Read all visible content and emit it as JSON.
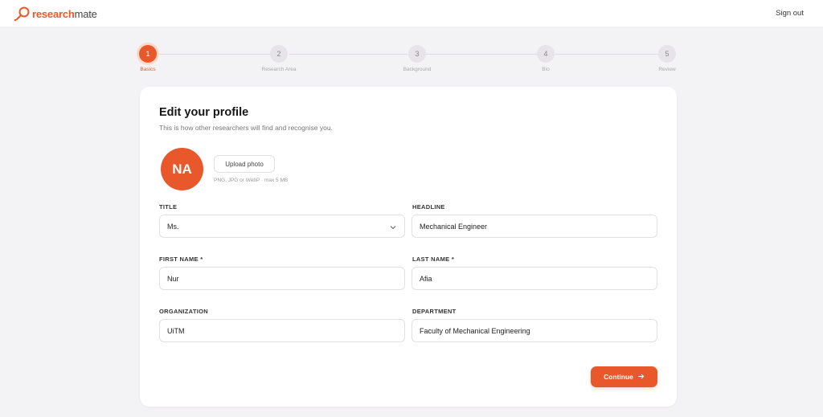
{
  "brand": {
    "name_part1": "research",
    "name_part2": "mate",
    "accent_color": "#e8582a"
  },
  "header": {
    "signout_label": "Sign out"
  },
  "stepper": {
    "current_step": 1,
    "steps": [
      {
        "number": "1",
        "label": "Basics"
      },
      {
        "number": "2",
        "label": "Research Area"
      },
      {
        "number": "3",
        "label": "Background"
      },
      {
        "number": "4",
        "label": "Bio"
      },
      {
        "number": "5",
        "label": "Review"
      }
    ]
  },
  "profile": {
    "title": "Edit your profile",
    "subtitle": "This is how other researchers will find and recognise you.",
    "avatar_initials": "NA",
    "upload_label": "Upload photo",
    "upload_hint": "PNG, JPG or WebP · max 5 MB"
  },
  "form": {
    "title": {
      "label": "TITLE",
      "value": "Ms."
    },
    "headline": {
      "label": "HEADLINE",
      "value": "Mechanical Engineer"
    },
    "first_name": {
      "label": "FIRST NAME *",
      "value": "Nur"
    },
    "last_name": {
      "label": "LAST NAME *",
      "value": "Afia"
    },
    "organization": {
      "label": "ORGANIZATION",
      "value": "UiTM"
    },
    "department": {
      "label": "DEPARTMENT",
      "value": "Faculty of Mechanical Engineering"
    }
  },
  "actions": {
    "continue_label": "Continue",
    "continue_icon": "arrow-right-icon"
  }
}
